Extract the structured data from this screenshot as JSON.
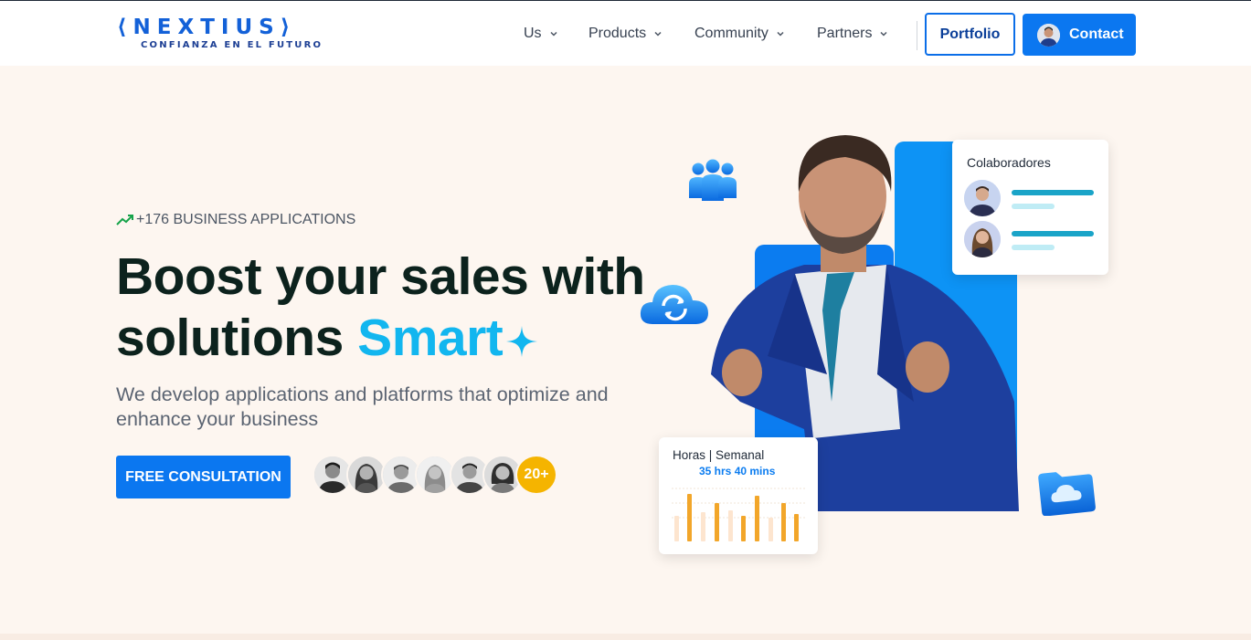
{
  "brand": {
    "name": "NEXTIUS",
    "tagline": "CONFIANZA EN EL FUTURO",
    "color": "#1361d8"
  },
  "nav": {
    "items": [
      {
        "label": "Us"
      },
      {
        "label": "Products"
      },
      {
        "label": "Community"
      },
      {
        "label": "Partners"
      }
    ],
    "portfolio_label": "Portfolio",
    "contact_label": "Contact"
  },
  "hero": {
    "kicker": "+176 BUSINESS APPLICATIONS",
    "headline_part1": "Boost your sales with solutions ",
    "headline_accent": "Smart",
    "subtitle": "We develop applications and platforms that optimize and enhance your business",
    "cta_label": "FREE CONSULTATION",
    "team_count": "20+",
    "accent_color": "#12b6ef",
    "primary_color": "#0b77f0"
  },
  "cards": {
    "collaborators_title": "Colaboradores",
    "hours_title": "Horas | Semanal",
    "hours_value": "35 hrs 40 mins"
  },
  "icons": [
    "chevron-down-icon",
    "trending-up-icon",
    "sparkle-icon",
    "people-icon",
    "cloud-sync-icon",
    "cloud-folder-icon"
  ]
}
